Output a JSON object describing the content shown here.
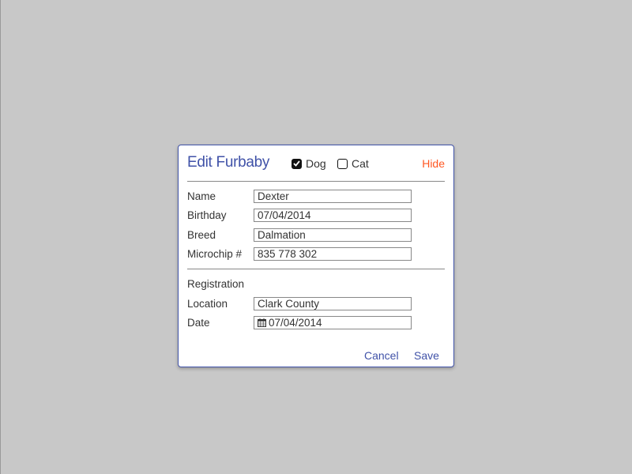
{
  "dialog": {
    "title": "Edit Furbaby",
    "species": [
      {
        "label": "Dog",
        "checked": true
      },
      {
        "label": "Cat",
        "checked": false
      }
    ],
    "hide_label": "Hide"
  },
  "fields": {
    "name": {
      "label": "Name",
      "value": "Dexter"
    },
    "birthday": {
      "label": "Birthday",
      "value": "07/04/2014"
    },
    "breed": {
      "label": "Breed",
      "value": "Dalmation"
    },
    "microchip": {
      "label": "Microchip #",
      "value": "835 778 302"
    }
  },
  "registration": {
    "heading": "Registration",
    "location": {
      "label": "Location",
      "value": "Clark County"
    },
    "date": {
      "label": "Date",
      "value": "07/04/2014",
      "icon": "calendar-icon"
    }
  },
  "footer": {
    "cancel_label": "Cancel",
    "save_label": "Save"
  },
  "colors": {
    "accent": "#4052a8",
    "hide": "#ff5722",
    "background": "#c8c8c8"
  }
}
